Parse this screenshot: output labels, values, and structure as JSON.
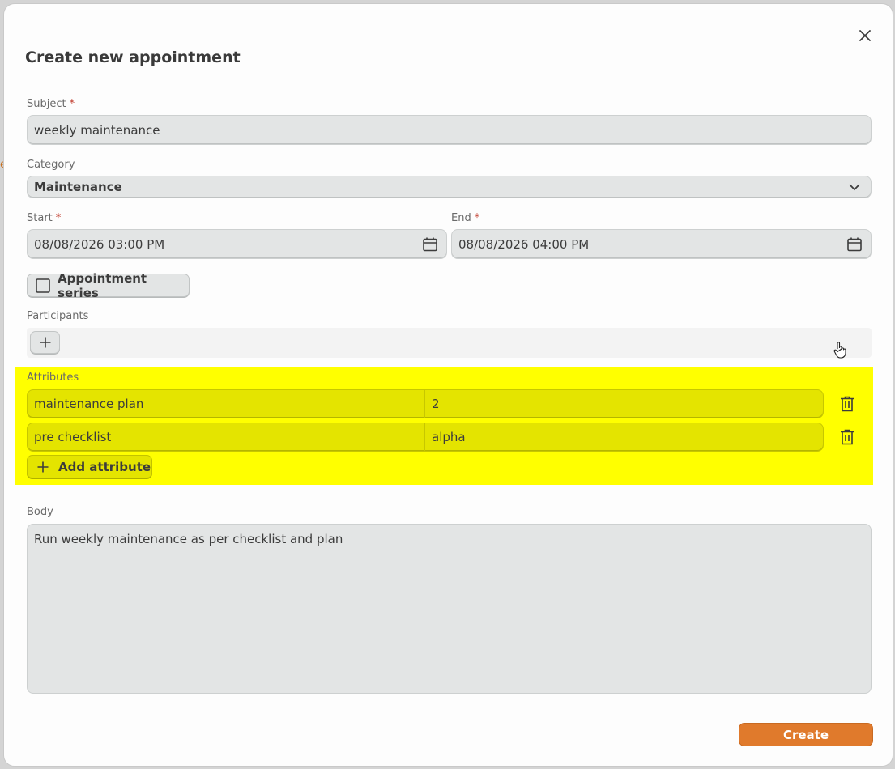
{
  "dialog": {
    "title": "Create new appointment"
  },
  "background": {
    "partial_mark": "e"
  },
  "form": {
    "subject": {
      "label": "Subject",
      "required_mark": "*",
      "value": "weekly maintenance"
    },
    "category": {
      "label": "Category",
      "value": "Maintenance"
    },
    "start": {
      "label": "Start",
      "required_mark": "*",
      "value": "08/08/2026 03:00 PM"
    },
    "end": {
      "label": "End",
      "required_mark": "*",
      "value": "08/08/2026 04:00 PM"
    },
    "series": {
      "label": "Appointment series",
      "checked": false
    },
    "participants": {
      "label": "Participants"
    },
    "attributes": {
      "label": "Attributes",
      "rows": [
        {
          "key": "maintenance plan",
          "value": "2"
        },
        {
          "key": "pre checklist",
          "value": "alpha"
        }
      ],
      "add_label": "Add attribute"
    },
    "body": {
      "label": "Body",
      "value": "Run weekly maintenance as per checklist and plan"
    }
  },
  "actions": {
    "create_label": "Create"
  },
  "colors": {
    "accent": "#e07a2c",
    "highlight": "#ffff00",
    "required": "#c0392b",
    "field_bg": "#e3e5e5"
  }
}
